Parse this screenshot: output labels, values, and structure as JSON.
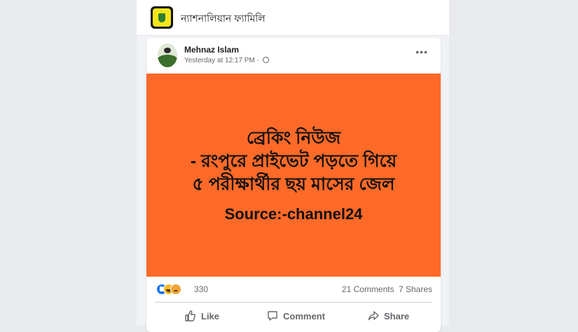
{
  "group": {
    "name": "ন্যাশনালিয়ান ফ্যামিলি"
  },
  "post": {
    "author": "Mehnaz Islam",
    "timestamp": "Yesterday at 12:17 PM",
    "privacy_sep": "·",
    "more_menu": "•••",
    "image_text": {
      "line1": "ব্রেকিং নিউজ",
      "line2": "- রংপুরে প্রাইভেট পড়তে গিয়ে",
      "line3": "৫ পরীক্ষার্থীর ছয় মাসের জেল",
      "source": "Source:-channel24"
    },
    "reactions": {
      "count": "330",
      "icons": [
        "like-icon",
        "haha-icon",
        "sad-icon"
      ]
    },
    "stats": {
      "comments": "21 Comments",
      "shares": "7 Shares"
    },
    "actions": {
      "like": "Like",
      "comment": "Comment",
      "share": "Share"
    }
  },
  "colors": {
    "banner": "#ff6a28",
    "page_bg": "#e9eaec",
    "accent": "#1877f2"
  }
}
